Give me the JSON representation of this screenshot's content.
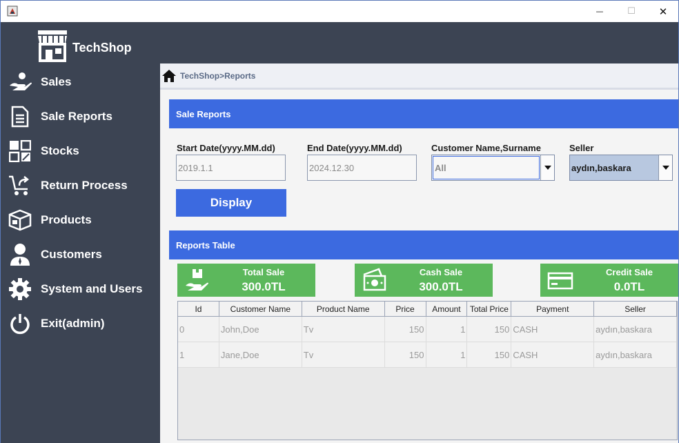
{
  "window": {
    "minimize_glyph": "—",
    "maximize_glyph": "☐",
    "close_glyph": "✕"
  },
  "brand": {
    "name": "TechShop",
    "icon": "store-icon"
  },
  "sidebar": {
    "items": [
      {
        "label": "Sales",
        "icon": "hand-coin-icon"
      },
      {
        "label": "Sale Reports",
        "icon": "document-icon"
      },
      {
        "label": "Stocks",
        "icon": "grid-boxes-icon"
      },
      {
        "label": "Return Process",
        "icon": "cart-return-icon"
      },
      {
        "label": "Products",
        "icon": "box-icon"
      },
      {
        "label": "Customers",
        "icon": "person-icon"
      },
      {
        "label": "System and Users",
        "icon": "gear-icon"
      },
      {
        "label": "Exit(admin)",
        "icon": "power-icon"
      }
    ]
  },
  "breadcrumb": {
    "text": "TechShop>Reports",
    "icon": "home-icon"
  },
  "sale_reports": {
    "header": "Sale Reports",
    "start_date_label": "Start Date(yyyy.MM.dd)",
    "start_date_value": "2019.1.1",
    "end_date_label": "End Date(yyyy.MM.dd)",
    "end_date_value": "2024.12.30",
    "customer_label": "Customer Name,Surname",
    "customer_value": "All",
    "seller_label": "Seller",
    "seller_value": "aydın,baskara",
    "display_button": "Display"
  },
  "reports_table": {
    "header": "Reports Table",
    "cards": [
      {
        "title": "Total Sale",
        "value": "300.0TL",
        "icon": "hand-box-icon"
      },
      {
        "title": "Cash Sale",
        "value": "300.0TL",
        "icon": "cash-icon"
      },
      {
        "title": "Credit Sale",
        "value": "0.0TL",
        "icon": "credit-card-icon"
      }
    ],
    "columns": [
      "Id",
      "Customer Name",
      "Product Name",
      "Price",
      "Amount",
      "Total Price",
      "Payment",
      "Seller"
    ],
    "rows": [
      [
        "0",
        "John,Doe",
        "Tv",
        "150",
        "1",
        "150",
        "CASH",
        "aydın,baskara"
      ],
      [
        "1",
        "Jane,Doe",
        "Tv",
        "150",
        "1",
        "150",
        "CASH",
        "aydın,baskara"
      ]
    ]
  },
  "colors": {
    "sidebar_bg": "#3c4453",
    "accent_blue": "#3c6ae0",
    "card_green": "#5cb85c",
    "seller_highlight": "#b8c8e0"
  }
}
